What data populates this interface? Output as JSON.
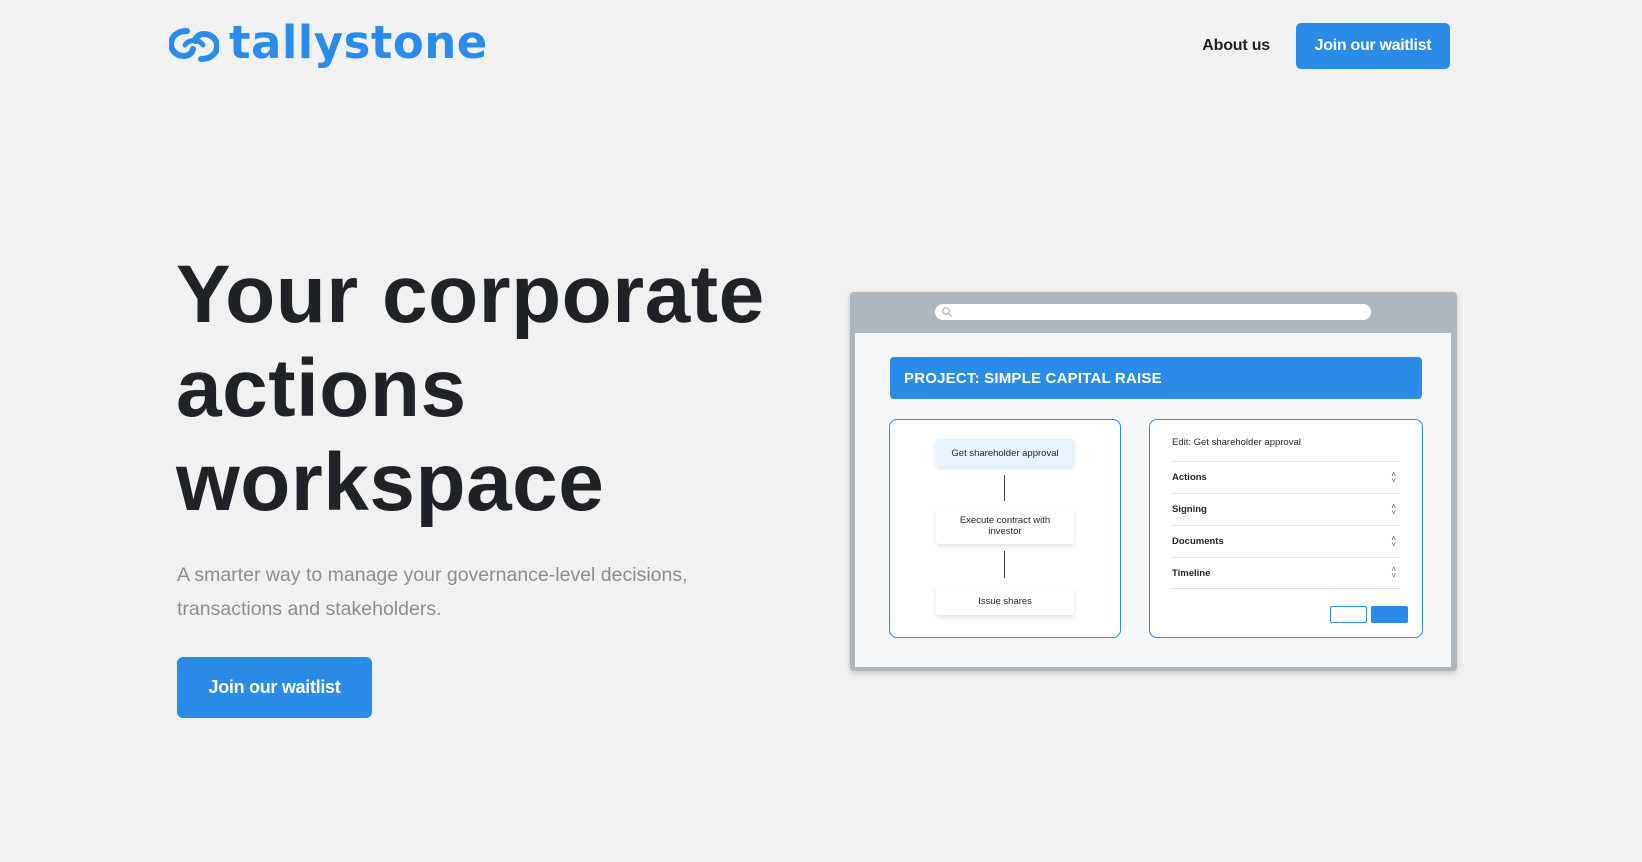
{
  "header": {
    "logo_text": "tallystone",
    "nav_about": "About us",
    "nav_cta": "Join our waitlist"
  },
  "hero": {
    "title_line1": "Your corporate",
    "title_line2": "actions",
    "title_line3": "workspace",
    "subtitle_line1": "A smarter way to manage your governance-level decisions,",
    "subtitle_line2": "transactions and stakeholders.",
    "cta": "Join our waitlist"
  },
  "mockup": {
    "project_title": "PROJECT: SIMPLE CAPITAL RAISE",
    "flow_steps": [
      "Get shareholder approval",
      "Execute contract with investor",
      "Issue shares"
    ],
    "edit_title": "Edit: Get shareholder approval",
    "edit_rows": [
      "Actions",
      "Signing",
      "Documents",
      "Timeline"
    ]
  },
  "colors": {
    "brand": "#2a8ce7",
    "background": "#f1f1f1",
    "heading": "#1f2227",
    "muted": "#8a8d92"
  },
  "icons": {
    "logo": "tallystone-swirl-logo-icon",
    "search": "search-icon",
    "row_chevron": "chevron-up-down-icon"
  }
}
